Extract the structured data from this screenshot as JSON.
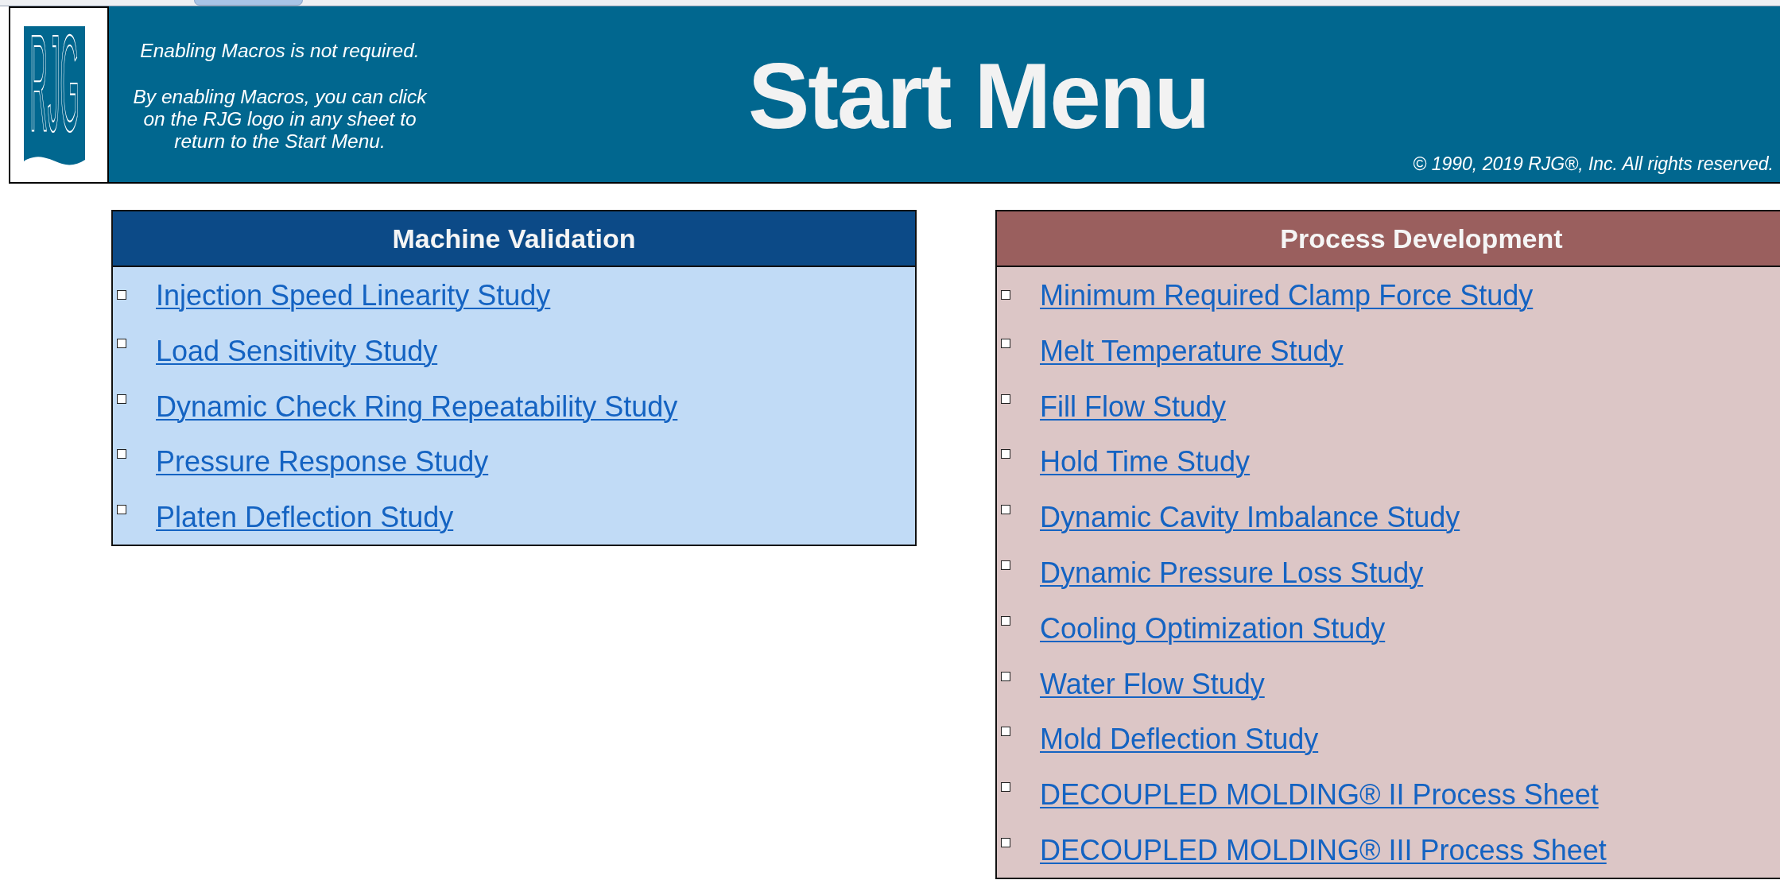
{
  "header": {
    "logo": "RJG",
    "notes": [
      "Enabling Macros is not required.",
      "By enabling Macros, you can click\non the RJG logo in any sheet to\nreturn to the Start Menu."
    ],
    "title": "Start Menu",
    "copyright": "© 1990, 2019 RJG®, Inc. All rights reserved."
  },
  "panels": [
    {
      "title": "Machine Validation",
      "color": "#0c4a87",
      "links": [
        "Injection Speed Linearity Study",
        "Load Sensitivity Study",
        "Dynamic Check Ring Repeatability Study",
        "Pressure Response Study",
        "Platen Deflection Study"
      ]
    },
    {
      "title": "Process Development",
      "color": "#9a5f5e",
      "links": [
        "Minimum Required Clamp Force Study",
        "Melt Temperature Study",
        "Fill Flow Study",
        "Hold Time Study",
        "Dynamic Cavity Imbalance Study",
        "Dynamic Pressure Loss Study",
        "Cooling Optimization Study",
        "Water Flow Study",
        "Mold Deflection Study",
        "DECOUPLED MOLDING® II Process Sheet",
        "DECOUPLED MOLDING® III Process Sheet"
      ]
    }
  ]
}
